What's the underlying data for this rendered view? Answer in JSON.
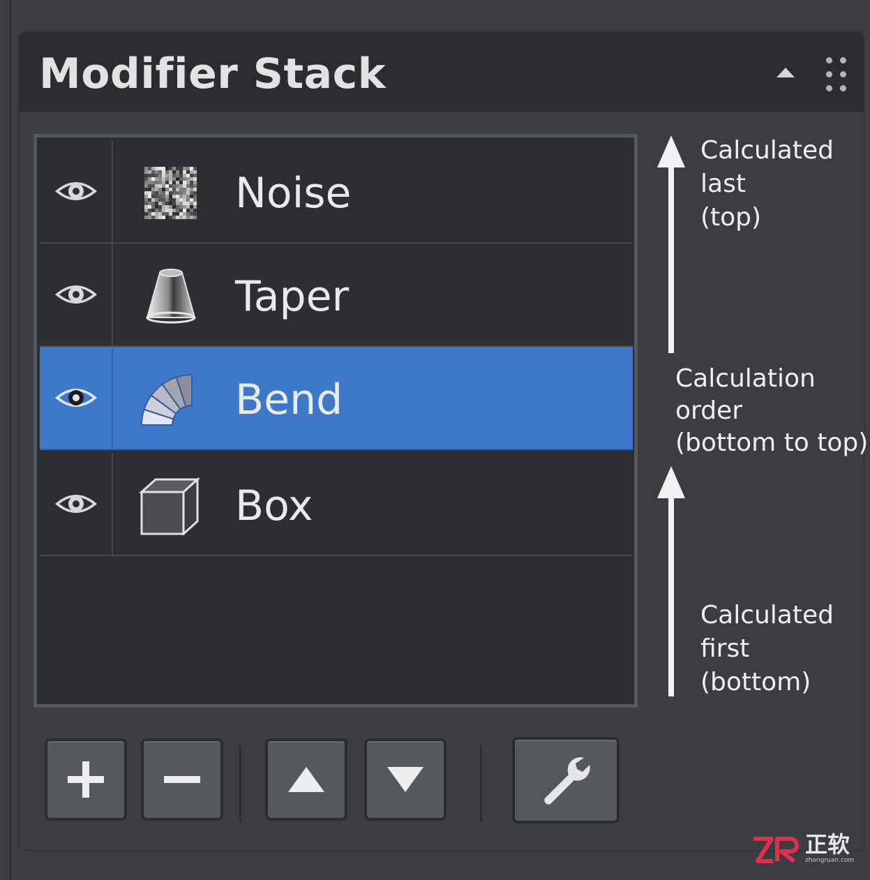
{
  "panel": {
    "title": "Modifier Stack",
    "collapse_icon": "triangle-up-icon",
    "grip_icon": "drag-grip-icon"
  },
  "stack": {
    "items": [
      {
        "label": "Noise",
        "icon": "noise-icon",
        "visible": true,
        "selected": false
      },
      {
        "label": "Taper",
        "icon": "taper-icon",
        "visible": true,
        "selected": false
      },
      {
        "label": "Bend",
        "icon": "bend-icon",
        "visible": true,
        "selected": true
      },
      {
        "label": "Box",
        "icon": "box-icon",
        "visible": true,
        "selected": false
      }
    ]
  },
  "annotations": {
    "top": "Calculated\nlast\n(top)",
    "middle": "Calculation\norder\n(bottom to top)",
    "bottom": "Calculated\nfirst\n(bottom)"
  },
  "toolbar": {
    "buttons": [
      {
        "name": "add-modifier-button",
        "icon": "plus-icon"
      },
      {
        "name": "remove-modifier-button",
        "icon": "minus-icon"
      },
      {
        "name": "move-up-button",
        "icon": "triangle-up-icon"
      },
      {
        "name": "move-down-button",
        "icon": "triangle-down-icon"
      },
      {
        "name": "settings-button",
        "icon": "wrench-icon"
      }
    ]
  },
  "watermark": {
    "logo": "2R",
    "text": "正软",
    "sub": "zhongruan.com"
  },
  "colors": {
    "background": "#3b3d42",
    "header": "#2a2c31",
    "list_bg": "#2c2e33",
    "selected": "#3d78c9",
    "text": "#eaeaea",
    "watermark_accent": "#e0304e"
  }
}
